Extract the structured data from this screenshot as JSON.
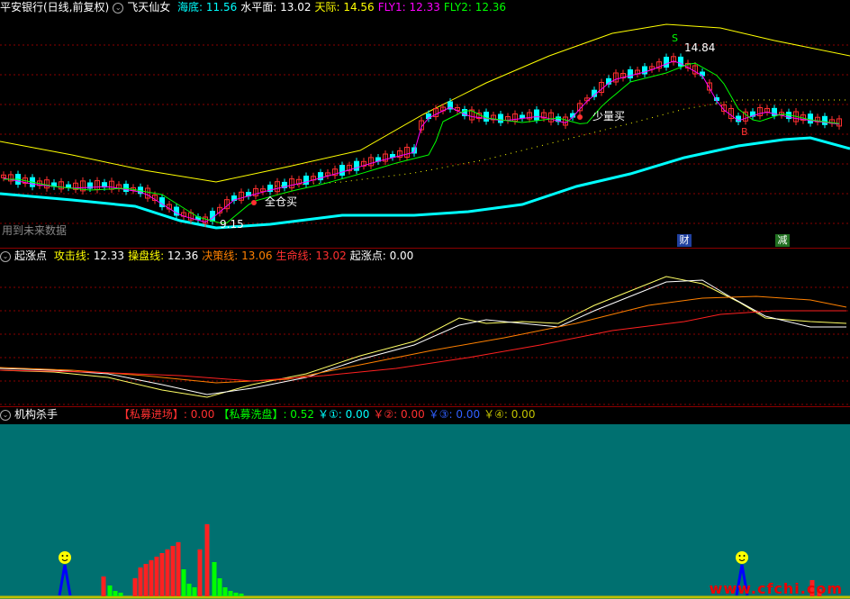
{
  "panel1": {
    "stock": "平安银行(日线,前复权)",
    "indicator": "飞天仙女",
    "items": [
      {
        "label": "海底:",
        "value": "11.56",
        "color": "#00ffff"
      },
      {
        "label": "水平面:",
        "value": "13.02",
        "color": "#ffffff"
      },
      {
        "label": "天际:",
        "value": "14.56",
        "color": "#ffff00"
      },
      {
        "label": "FLY1:",
        "value": "12.33",
        "color": "#ff00ff"
      },
      {
        "label": "FLY2:",
        "value": "12.36",
        "color": "#00ff00"
      }
    ],
    "future_note": "用到未来数据",
    "high_label": "14.84",
    "low_label": "9.15",
    "buy_all": "全仓买",
    "buy_little": "少量买",
    "s_mark": "S",
    "b_mark": "B",
    "badge_cai": "财",
    "badge_jian": "减"
  },
  "panel2": {
    "title": "起涨点",
    "items": [
      {
        "label": "攻击线:",
        "value": "12.33",
        "color": "#ffffff",
        "labelColor": "#ffff00"
      },
      {
        "label": "操盘线:",
        "value": "12.36",
        "color": "#ffffff",
        "labelColor": "#ffff00"
      },
      {
        "label": "决策线:",
        "value": "13.06",
        "color": "#ff8000",
        "labelColor": "#ff8000"
      },
      {
        "label": "生命线:",
        "value": "13.02",
        "color": "#ff3030",
        "labelColor": "#ff3030"
      },
      {
        "label": "起涨点:",
        "value": "0.00",
        "color": "#ffffff",
        "labelColor": "#ffffff"
      }
    ]
  },
  "panel3": {
    "title": "机构杀手",
    "items": [
      {
        "label": "【私募进场】:",
        "value": "0.00",
        "color": "#ff3030"
      },
      {
        "label": "【私募洗盘】:",
        "value": "0.52",
        "color": "#00ff00"
      },
      {
        "label": "￥①:",
        "value": "0.00",
        "color": "#00ffff"
      },
      {
        "label": "￥②:",
        "value": "0.00",
        "color": "#ff3030"
      },
      {
        "label": "￥③:",
        "value": "0.00",
        "color": "#3060ff"
      },
      {
        "label": "￥④:",
        "value": "0.00",
        "color": "#c0c000"
      }
    ]
  },
  "watermark": "www.cfchi.com",
  "colors": {
    "bg": "#000000",
    "panel3_bg": "#007070",
    "separator": "#8b0000",
    "up": "#ff3030",
    "down": "#00ffff"
  }
}
